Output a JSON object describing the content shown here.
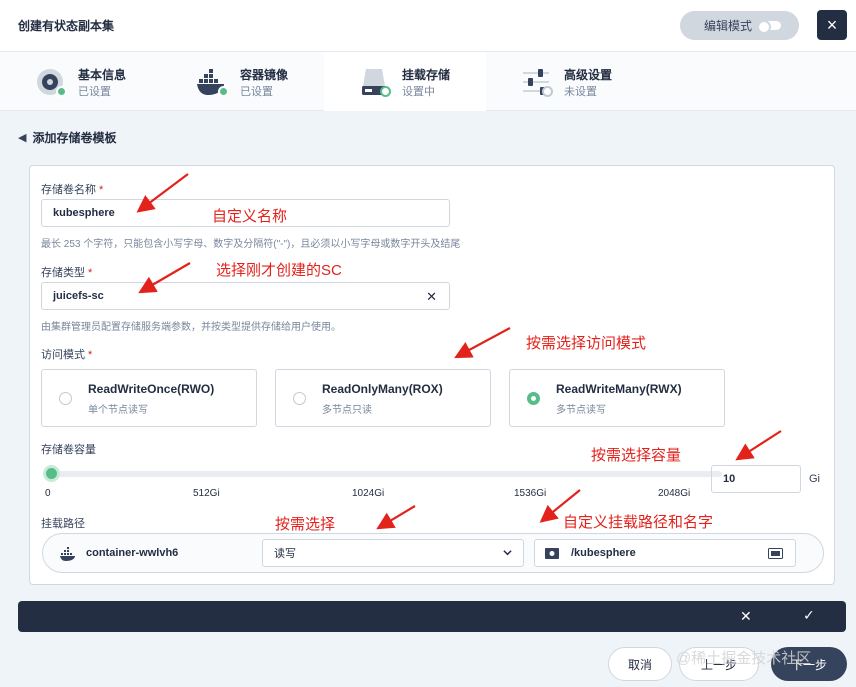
{
  "header": {
    "title": "创建有状态副本集",
    "edit_mode_label": "编辑模式",
    "close_icon": "×"
  },
  "steps": [
    {
      "name": "基本信息",
      "status": "已设置",
      "icon": "settings-disc-icon",
      "status_color": "#55bc8a"
    },
    {
      "name": "容器镜像",
      "status": "已设置",
      "icon": "docker-whale-icon",
      "status_color": "#55bc8a"
    },
    {
      "name": "挂载存储",
      "status": "设置中",
      "icon": "storage-disk-icon",
      "status_color": "#ffffff"
    },
    {
      "name": "高级设置",
      "status": "未设置",
      "icon": "sliders-icon",
      "status_color": "#ffffff"
    }
  ],
  "back": {
    "label": "添加存储卷模板"
  },
  "form": {
    "name": {
      "label": "存储卷名称",
      "required": "*",
      "value": "kubesphere",
      "hint": "最长 253 个字符，只能包含小写字母、数字及分隔符(\"-\")，且必须以小写字母或数字开头及结尾"
    },
    "storage_class": {
      "label": "存储类型",
      "required": "*",
      "value": "juicefs-sc",
      "hint": "由集群管理员配置存储服务端参数，并按类型提供存储给用户使用。"
    },
    "access_mode": {
      "label": "访问模式",
      "required": "*",
      "options": [
        {
          "title": "ReadWriteOnce(RWO)",
          "sub": "单个节点读写",
          "selected": false
        },
        {
          "title": "ReadOnlyMany(ROX)",
          "sub": "多节点只读",
          "selected": false
        },
        {
          "title": "ReadWriteMany(RWX)",
          "sub": "多节点读写",
          "selected": true
        }
      ]
    },
    "capacity": {
      "label": "存储卷容量",
      "ticks": [
        "0",
        "512Gi",
        "1024Gi",
        "1536Gi",
        "2048Gi"
      ],
      "value": "10",
      "unit": "Gi",
      "slider_fraction": 0.005
    },
    "mount": {
      "label": "挂载路径",
      "container": "container-wwlvh6",
      "mode_value": "读写",
      "path_value": "/kubesphere"
    }
  },
  "footer": {
    "cancel": "取消",
    "prev": "上一步",
    "next": "下一步"
  },
  "annotations": {
    "custom_name": "自定义名称",
    "choose_sc": "选择刚才创建的SC",
    "choose_access": "按需选择访问模式",
    "choose_capacity": "按需选择容量",
    "choose": "按需选择",
    "custom_path": "自定义挂载路径和名字"
  },
  "watermark": "@稀土掘金技术社区",
  "colors": {
    "accent_green": "#55bc8a",
    "dark": "#242e42",
    "annotation_red": "#e3221c"
  }
}
